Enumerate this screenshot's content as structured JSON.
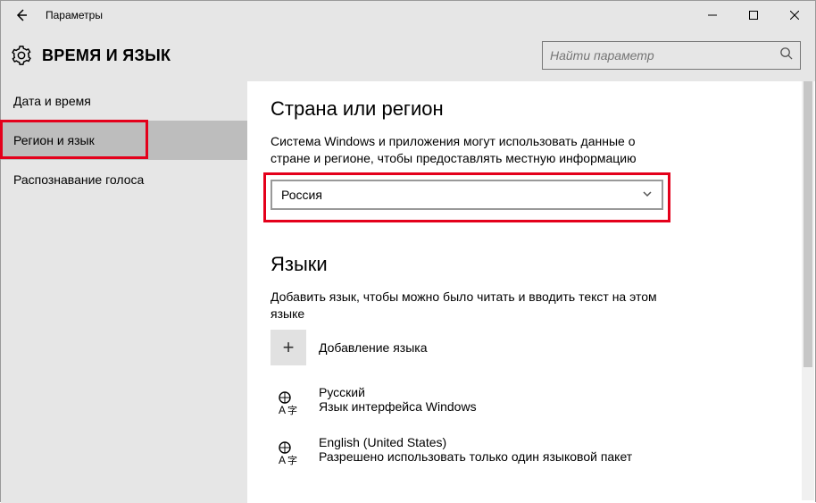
{
  "window": {
    "title": "Параметры"
  },
  "header": {
    "heading": "ВРЕМЯ И ЯЗЫК",
    "search_placeholder": "Найти параметр"
  },
  "sidebar": {
    "items": [
      {
        "label": "Дата и время"
      },
      {
        "label": "Регион и язык"
      },
      {
        "label": "Распознавание голоса"
      }
    ]
  },
  "content": {
    "region_heading": "Страна или регион",
    "region_desc": "Система Windows и приложения могут использовать данные о стране и регионе, чтобы предоставлять местную информацию",
    "region_value": "Россия",
    "lang_heading": "Языки",
    "lang_desc": "Добавить язык, чтобы можно было читать и вводить текст на этом языке",
    "add_lang_label": "Добавление языка",
    "languages": [
      {
        "name": "Русский",
        "sub": "Язык интерфейса Windows"
      },
      {
        "name": "English (United States)",
        "sub": "Разрешено использовать только один языковой пакет"
      }
    ]
  }
}
